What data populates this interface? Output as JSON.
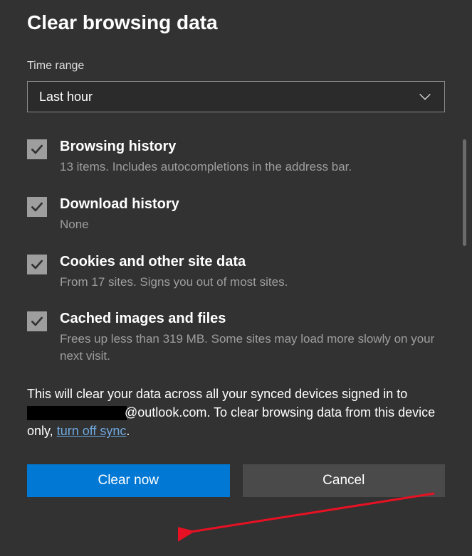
{
  "title": "Clear browsing data",
  "time_range": {
    "label": "Time range",
    "value": "Last hour"
  },
  "options": [
    {
      "label": "Browsing history",
      "desc": "13 items. Includes autocompletions in the address bar."
    },
    {
      "label": "Download history",
      "desc": "None"
    },
    {
      "label": "Cookies and other site data",
      "desc": "From 17 sites. Signs you out of most sites."
    },
    {
      "label": "Cached images and files",
      "desc": "Frees up less than 319 MB. Some sites may load more slowly on your next visit."
    }
  ],
  "info": {
    "prefix": "This will clear your data across all your synced devices signed in to ",
    "email_domain": "@outlook.com",
    "middle": ". To clear browsing data from this device only, ",
    "link": "turn off sync",
    "suffix": "."
  },
  "buttons": {
    "primary": "Clear now",
    "secondary": "Cancel"
  }
}
